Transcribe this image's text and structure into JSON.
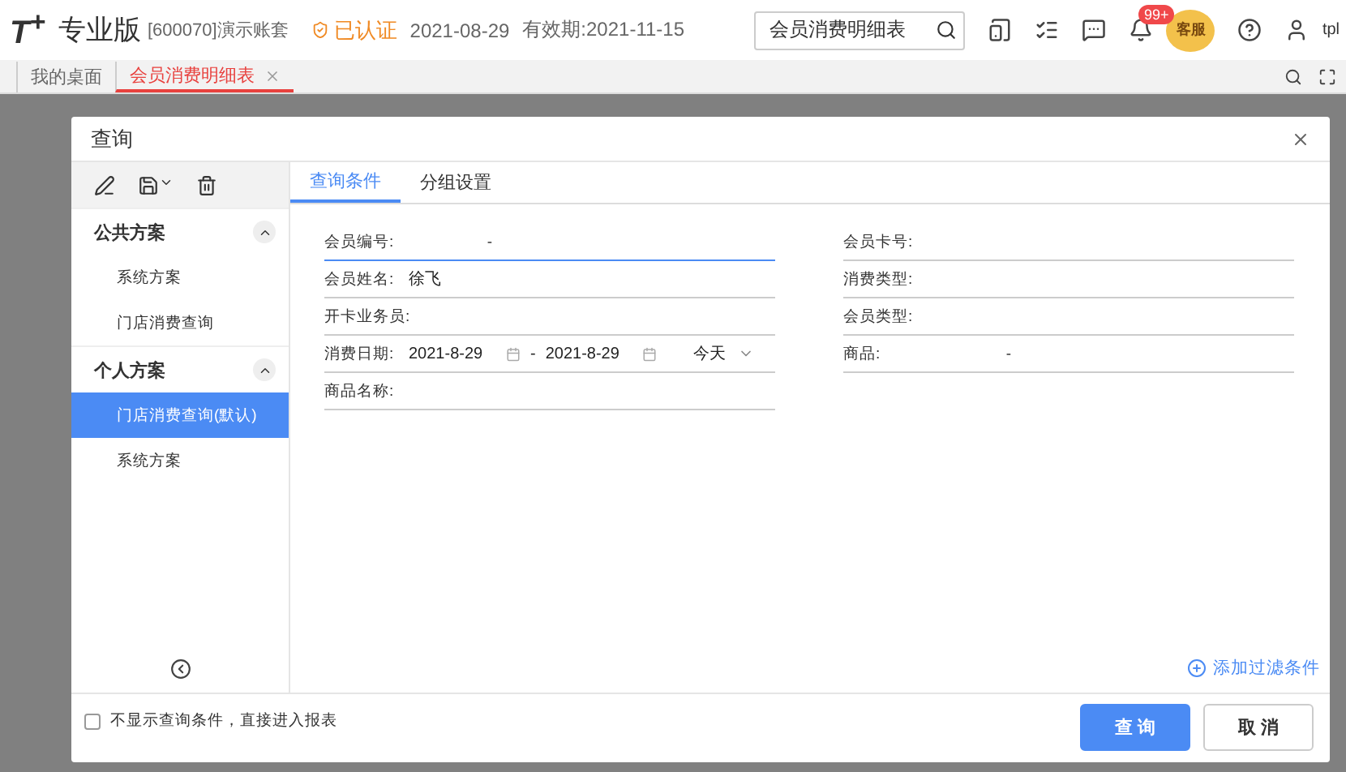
{
  "header": {
    "logo": "T$^{+}$",
    "edition": "专业版",
    "account": "[600070]演示账套",
    "certified": "已认证",
    "date": "2021-08-29",
    "expiry": "有效期:2021-11-15",
    "search": {
      "value": "会员消费明细表"
    },
    "badge": "99+",
    "service": "客服",
    "user": "tpl"
  },
  "tabs": [
    {
      "label": "我的桌面",
      "selected": false,
      "closable": false
    },
    {
      "label": "会员消费明细表",
      "selected": true,
      "closable": true
    }
  ],
  "dialog": {
    "title": "查询",
    "groups": [
      {
        "label": "公共方案",
        "expanded": true,
        "items": [
          {
            "label": "系统方案",
            "selected": false
          },
          {
            "label": "门店消费查询",
            "selected": false
          }
        ]
      },
      {
        "label": "个人方案",
        "expanded": true,
        "items": [
          {
            "label": "门店消费查询(默认)",
            "selected": true
          },
          {
            "label": "系统方案",
            "selected": false
          }
        ]
      }
    ],
    "form_tabs": [
      {
        "label": "查询条件",
        "selected": true
      },
      {
        "label": "分组设置",
        "selected": false
      }
    ],
    "left_fields": [
      {
        "kind": "range",
        "label": "会员编号:",
        "separator": "-",
        "focused": true
      },
      {
        "kind": "text",
        "label": "会员姓名:",
        "value": "徐飞",
        "focused": false
      },
      {
        "kind": "text",
        "label": "开卡业务员:",
        "focused": false
      },
      {
        "kind": "date",
        "label": "消费日期:",
        "from": "2021-8-29",
        "separator": "-",
        "to": "2021-8-29",
        "preset": "今天",
        "focused": false
      },
      {
        "kind": "text",
        "label": "商品名称:",
        "focused": false
      }
    ],
    "right_fields": [
      {
        "kind": "text",
        "label": "会员卡号:",
        "focused": false
      },
      {
        "kind": "text",
        "label": "消费类型:",
        "focused": false
      },
      {
        "kind": "text",
        "label": "会员类型:",
        "focused": false
      },
      {
        "kind": "range",
        "label": "商品:",
        "separator": "-",
        "focused": false
      }
    ],
    "add_filter": "添加过滤条件",
    "skip_option": {
      "label": "不显示查询条件，直接进入报表",
      "checked": false
    },
    "buttons": [
      {
        "label": "查 询",
        "kind": "primary"
      },
      {
        "label": "取 消",
        "kind": "default"
      }
    ]
  }
}
